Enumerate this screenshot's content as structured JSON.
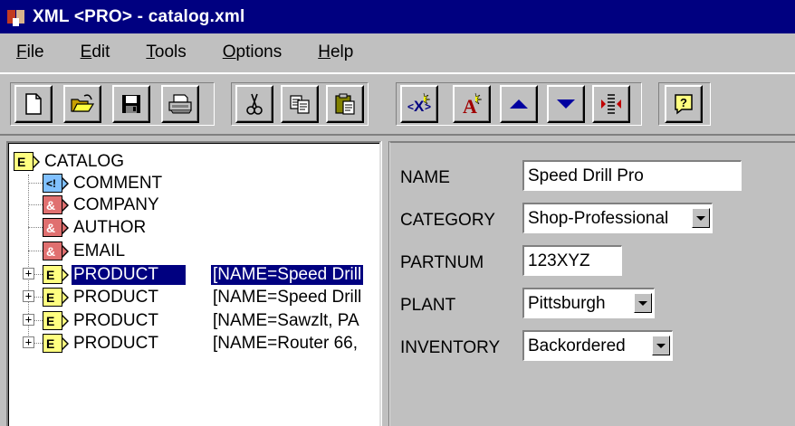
{
  "window": {
    "title": "XML <PRO> - catalog.xml"
  },
  "menu": [
    {
      "accel": "F",
      "rest": "ile"
    },
    {
      "accel": "E",
      "rest": "dit"
    },
    {
      "accel": "T",
      "rest": "ools"
    },
    {
      "accel": "O",
      "rest": "ptions"
    },
    {
      "accel": "H",
      "rest": "elp"
    }
  ],
  "tree": {
    "root": {
      "badge": "E",
      "label": "CATALOG"
    },
    "children": [
      {
        "badge": "<!",
        "label": "COMMENT"
      },
      {
        "badge": "&",
        "label": "COMPANY"
      },
      {
        "badge": "&",
        "label": "AUTHOR"
      },
      {
        "badge": "&",
        "label": "EMAIL"
      },
      {
        "badge": "E",
        "label": "PRODUCT",
        "attr": "[NAME=Speed Drill",
        "selected": true
      },
      {
        "badge": "E",
        "label": "PRODUCT",
        "attr": "[NAME=Speed Drill"
      },
      {
        "badge": "E",
        "label": "PRODUCT",
        "attr": "[NAME=Sawzlt, PA"
      },
      {
        "badge": "E",
        "label": "PRODUCT",
        "attr": "[NAME=Router 66,"
      }
    ],
    "expander_glyph": "+"
  },
  "details": {
    "fields": [
      {
        "label": "NAME",
        "value": "Speed Drill Pro",
        "kind": "text"
      },
      {
        "label": "CATEGORY",
        "value": "Shop-Professional",
        "kind": "select"
      },
      {
        "label": "PARTNUM",
        "value": "123XYZ",
        "kind": "text"
      },
      {
        "label": "PLANT",
        "value": "Pittsburgh",
        "kind": "select"
      },
      {
        "label": "INVENTORY",
        "value": "Backordered",
        "kind": "select"
      }
    ]
  },
  "toolbar": {
    "icons": [
      "new-file-icon",
      "open-folder-icon",
      "save-icon",
      "print-icon",
      "cut-icon",
      "copy-icon",
      "paste-icon",
      "add-element-icon",
      "add-attribute-icon",
      "move-up-icon",
      "move-down-icon",
      "sort-icon",
      "help-icon"
    ]
  },
  "colors": {
    "title_bg": "#000080",
    "selection_bg": "#000080",
    "element_badge": "#ffff80",
    "comment_badge": "#80c0ff",
    "entity_badge": "#e07070",
    "arrow_blue": "#0000a0"
  }
}
